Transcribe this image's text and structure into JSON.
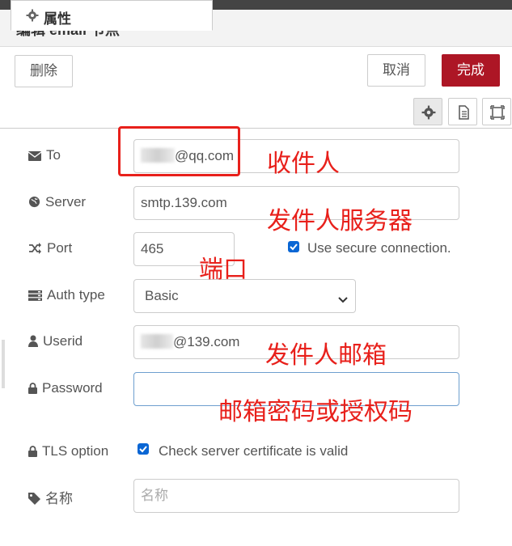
{
  "dialog": {
    "title": "编辑 email 节点",
    "delete_label": "删除",
    "cancel_label": "取消",
    "done_label": "完成"
  },
  "tabs": {
    "properties_label": "属性"
  },
  "colors": {
    "primary": "#ad1625",
    "annotation": "#e8201b",
    "checkbox": "#0a66d4"
  },
  "icons": [
    "gear-icon",
    "description-icon",
    "appearance-icon",
    "envelope-icon",
    "globe-icon",
    "random-icon",
    "server-icon",
    "user-icon",
    "lock-icon",
    "tag-icon",
    "chevron-down-icon",
    "checkmark-icon"
  ],
  "form": {
    "to": {
      "label": "To",
      "value_suffix": "@qq.com"
    },
    "server": {
      "label": "Server",
      "value": "smtp.139.com"
    },
    "port": {
      "label": "Port",
      "value": "465",
      "secure_label": "Use secure connection.",
      "secure_checked": true
    },
    "auth": {
      "label": "Auth type",
      "value": "Basic"
    },
    "userid": {
      "label": "Userid",
      "value_suffix": "@139.com"
    },
    "password": {
      "label": "Password",
      "value": ""
    },
    "tls": {
      "label": "TLS option",
      "check_label": "Check server certificate is valid",
      "checked": true
    },
    "name": {
      "label": "名称",
      "placeholder": "名称"
    }
  },
  "annotations": {
    "recipient": "收件人",
    "sender_server": "发件人服务器",
    "port": "端口",
    "sender_email": "发件人邮箱",
    "password": "邮箱密码或授权码"
  }
}
